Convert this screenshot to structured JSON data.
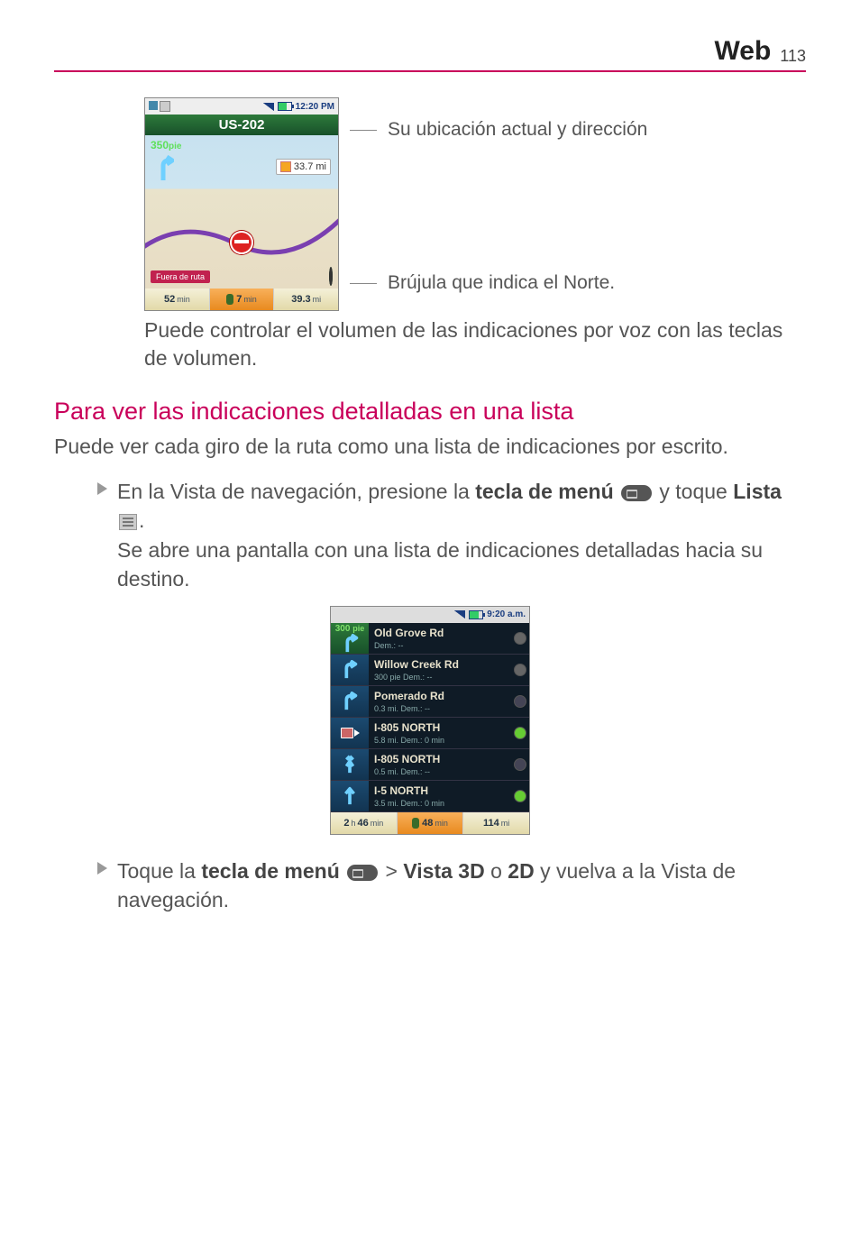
{
  "header": {
    "title": "Web",
    "page": "113"
  },
  "fig1": {
    "status_time": "12:20 PM",
    "road": "US-202",
    "dist_num": "350",
    "dist_unit": "pie",
    "mile_box": "33.7 mi",
    "offroute": "Fuera de ruta",
    "bottom": {
      "left_num": "52",
      "left_unit": "min",
      "mid_num": "7",
      "mid_unit": "min",
      "right_num": "39.3",
      "right_unit": "mi"
    },
    "annot1": "Su ubicación actual y dirección",
    "annot2": "Brújula que indica el Norte."
  },
  "caption1": "Puede controlar el volumen de las indicaciones por voz con las teclas de volumen.",
  "h2": "Para ver las indicaciones detalladas en una lista",
  "intro": "Puede ver cada giro de la ruta como una lista de indicaciones por escrito.",
  "bullet1": {
    "pre": "En la Vista de navegación, presione la ",
    "bold1": "tecla de menú",
    "mid1": "  y toque ",
    "bold2": "Lista",
    "post1": ".",
    "line2": "Se abre una pantalla con una lista de indicaciones detalladas hacia su destino."
  },
  "fig2": {
    "status_time": "9:20 a.m.",
    "first": {
      "num": "300",
      "unit": "pie"
    },
    "rows": [
      {
        "road": "Old Grove Rd",
        "meta": "Dem.: --",
        "dot": "gray",
        "icon": "first"
      },
      {
        "road": "Willow Creek Rd",
        "meta": "300 pie   Dem.: --",
        "dot": "gray",
        "icon": "turn-right"
      },
      {
        "road": "Pomerado Rd",
        "meta": "0.3 mi.   Dem.: --",
        "dot": "dark",
        "icon": "turn-right"
      },
      {
        "road": "I-805 NORTH",
        "meta": "5.8 mi.   Dem.: 0 min",
        "dot": "green",
        "icon": "exit"
      },
      {
        "road": "I-805 NORTH",
        "meta": "0.5 mi.   Dem.: --",
        "dot": "dark",
        "icon": "merge"
      },
      {
        "road": "I-5 NORTH",
        "meta": "3.5 mi.   Dem.: 0 min",
        "dot": "green",
        "icon": "straight"
      }
    ],
    "bottom": {
      "left_num": "2",
      "left_h": "h",
      "left_num2": "46",
      "left_unit": "min",
      "mid_num": "48",
      "mid_unit": "min",
      "right_num": "114",
      "right_unit": "mi"
    }
  },
  "bullet2": {
    "pre": "Toque la ",
    "bold1": "tecla de menú",
    "mid1": "  > ",
    "bold2": "Vista 3D",
    "mid2": " o ",
    "bold3": "2D",
    "post": " y vuelva a la Vista de navegación."
  }
}
